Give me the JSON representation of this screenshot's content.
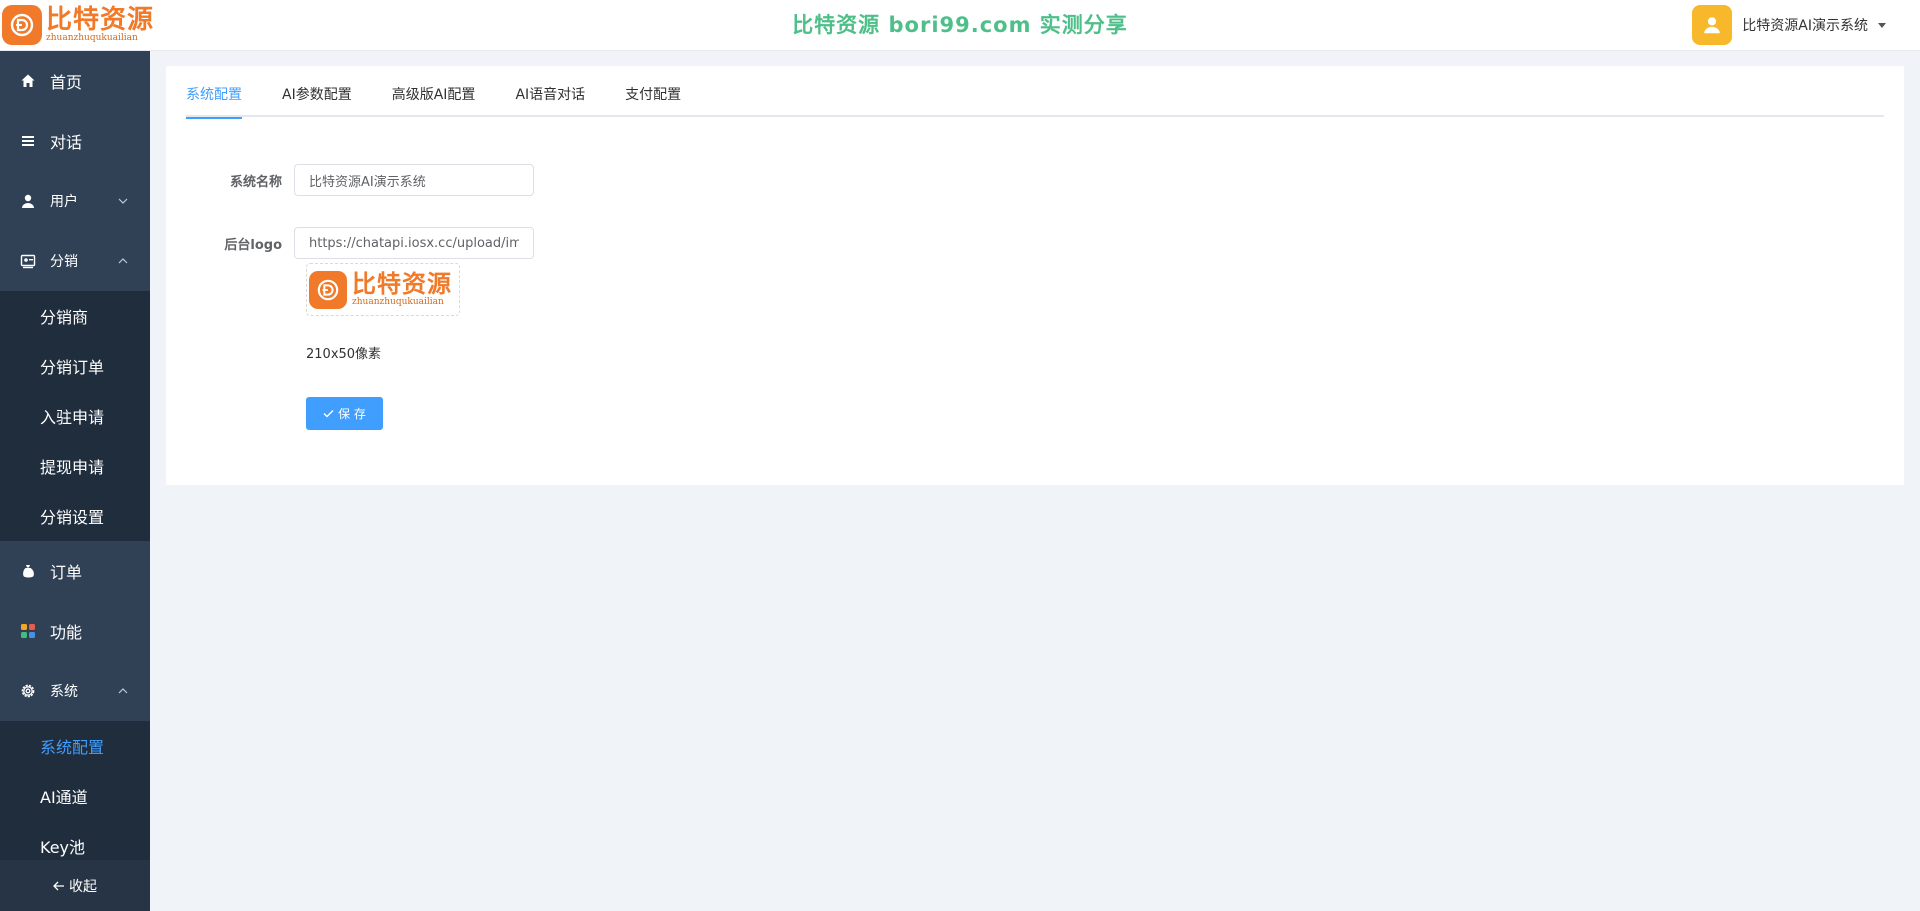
{
  "header": {
    "logo_main": "比特资源",
    "logo_sub": "zhuanzhuqukuailian",
    "banner": "比特资源 bori99.com 实测分享",
    "user_name": "比特资源AI演示系统",
    "avatar_icon": "user-icon"
  },
  "sidebar": {
    "items": [
      {
        "label": "首页",
        "icon": "home-icon"
      },
      {
        "label": "对话",
        "icon": "list-icon"
      },
      {
        "label": "用户",
        "icon": "user-icon",
        "expanded": false
      },
      {
        "label": "分销",
        "icon": "distribution-icon",
        "expanded": true
      },
      {
        "label": "订单",
        "icon": "money-bag-icon"
      },
      {
        "label": "功能",
        "icon": "apps-icon"
      },
      {
        "label": "系统",
        "icon": "gear-icon",
        "expanded": true
      }
    ],
    "distribution_sub": [
      "分销商",
      "分销订单",
      "入驻申请",
      "提现申请",
      "分销设置"
    ],
    "system_sub": [
      "系统配置",
      "AI通道",
      "Key池"
    ],
    "active_sub": "系统配置",
    "collapse_label": "收起"
  },
  "tabs": [
    "系统配置",
    "AI参数配置",
    "高级版AI配置",
    "AI语音对话",
    "支付配置"
  ],
  "active_tab": "系统配置",
  "form": {
    "system_name_label": "系统名称",
    "system_name_value": "比特资源AI演示系统",
    "logo_label": "后台logo",
    "logo_value": "https://chatapi.iosx.cc/upload/image.png",
    "logo_preview_main": "比特资源",
    "logo_preview_sub": "zhuanzhuqukuailian",
    "size_hint": "210x50像素",
    "save_label": "保 存"
  },
  "colors": {
    "brand_orange": "#f07a2a",
    "banner_green": "#4fbf8a",
    "sidebar_bg": "#304156",
    "submenu_bg": "#1f2d3d",
    "primary": "#409eff",
    "avatar_yellow": "#f8b82c"
  }
}
